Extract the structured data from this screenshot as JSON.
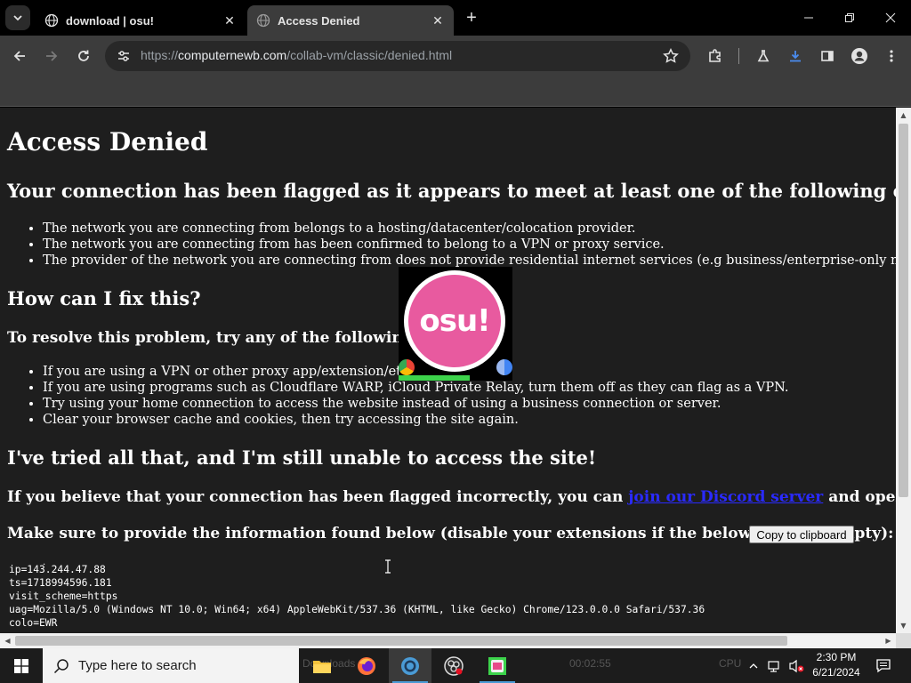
{
  "browser": {
    "tabs": [
      {
        "title": "download | osu!",
        "active": false,
        "favicon": "globe-icon"
      },
      {
        "title": "Access Denied",
        "active": true,
        "favicon": "globe-icon"
      }
    ],
    "address": {
      "scheme": "https://",
      "host": "computernewb.com",
      "path": "/collab-vm/classic/denied.html"
    }
  },
  "page": {
    "heading": "Access Denied",
    "flag_heading": "Your connection has been flagged as it appears to meet at least one of the following criteria:",
    "criteria": [
      "The network you are connecting from belongs to a hosting/datacenter/colocation provider.",
      "The network you are connecting from has been confirmed to belong to a VPN or proxy service.",
      "The provider of the network you are connecting from does not provide residential internet services (e.g business/enterprise-only networks)."
    ],
    "fix_heading": "How can I fix this?",
    "resolve_heading": "To resolve this problem, try any of the following:",
    "fixes": [
      "If you are using a VPN or other proxy app/extension/etc, try di",
      "If you are using programs such as Cloudflare WARP, iCloud Private Relay, turn them off as they can flag as a VPN.",
      "Try using your home connection to access the website instead of using a business connection or server.",
      "Clear your browser cache and cookies, then try accessing the site again."
    ],
    "tried_heading": "I've tried all that, and I'm still unable to access the site!",
    "incorrect_prefix": "If you believe that your connection has been flagged incorrectly, you can ",
    "incorrect_link": "join our Discord server",
    "incorrect_suffix": " and open a ticket.",
    "provide_info": "Make sure to provide the information found below (disable your extensions if the below space is empty):",
    "copy_button": "Copy to clipboard",
    "info_lines": [
      "ip=143.244.47.88",
      "ts=1718994596.181",
      "visit_scheme=https",
      "uag=Mozilla/5.0 (Windows NT 10.0; Win64; x64) AppleWebKit/537.36 (KHTML, like Gecko) Chrome/123.0.0.0 Safari/537.36",
      "colo=EWR"
    ]
  },
  "overlay": {
    "logo_text": "osu!"
  },
  "taskbar": {
    "search_placeholder": "Type here to search",
    "ghost_left": "Downloads",
    "ghost_mid": "00:02:55",
    "ghost_cpu": "CPU",
    "clock_time": "2:30 PM",
    "clock_date": "6/21/2024"
  },
  "colors": {
    "page_bg": "#1e1e1e",
    "chrome_bg": "#3c3c3c",
    "link": "#2a2aff",
    "osu_pink": "#e85a9f"
  }
}
